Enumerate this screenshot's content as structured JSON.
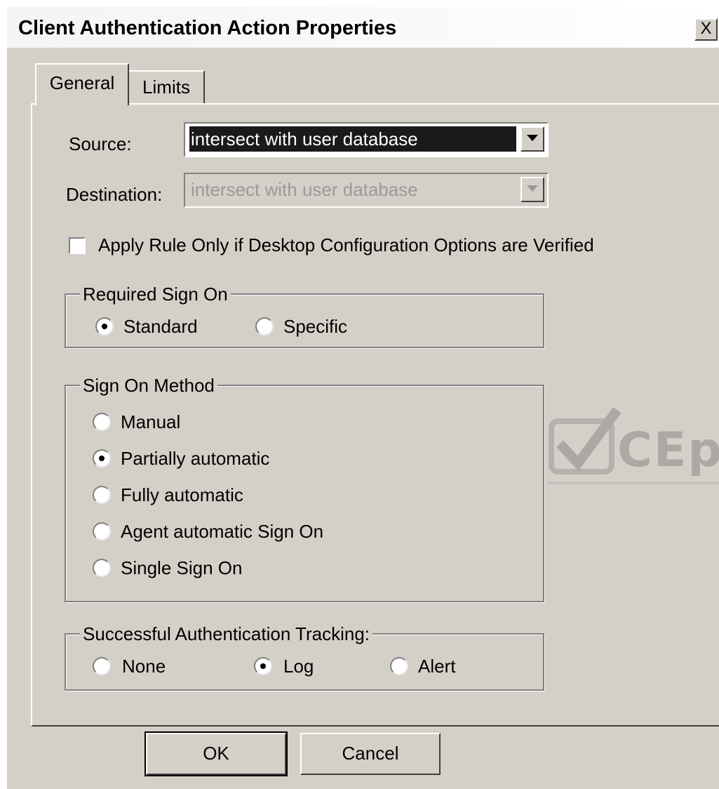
{
  "window": {
    "title": "Client Authentication Action Properties",
    "close_label": "X"
  },
  "tabs": [
    {
      "label": "General",
      "active": true
    },
    {
      "label": "Limits",
      "active": false
    }
  ],
  "source": {
    "label": "Source:",
    "value": "intersect with user database"
  },
  "destination": {
    "label": "Destination:",
    "value": "intersect with user database",
    "disabled": true
  },
  "desktop_check": {
    "label": "Apply Rule Only if Desktop Configuration Options are Verified",
    "checked": false
  },
  "required_sign_on": {
    "title": "Required Sign On",
    "options": [
      {
        "label": "Standard",
        "selected": true
      },
      {
        "label": "Specific",
        "selected": false
      }
    ]
  },
  "sign_on_method": {
    "title": "Sign On Method",
    "options": [
      {
        "label": "Manual",
        "selected": false
      },
      {
        "label": "Partially automatic",
        "selected": true
      },
      {
        "label": "Fully automatic",
        "selected": false
      },
      {
        "label": "Agent automatic Sign On",
        "selected": false
      },
      {
        "label": "Single Sign On",
        "selected": false
      }
    ]
  },
  "tracking": {
    "title": "Successful Authentication Tracking:",
    "options": [
      {
        "label": "None",
        "selected": false
      },
      {
        "label": "Log",
        "selected": true
      },
      {
        "label": "Alert",
        "selected": false
      }
    ]
  },
  "buttons": {
    "ok_label": "OK",
    "cancel_label": "Cancel"
  },
  "watermark": {
    "text": "CEp"
  },
  "colors": {
    "dialog_face": "#d4d0c8",
    "selection_bg": "#1a1a1a",
    "disabled_text": "#9a9a9a"
  }
}
